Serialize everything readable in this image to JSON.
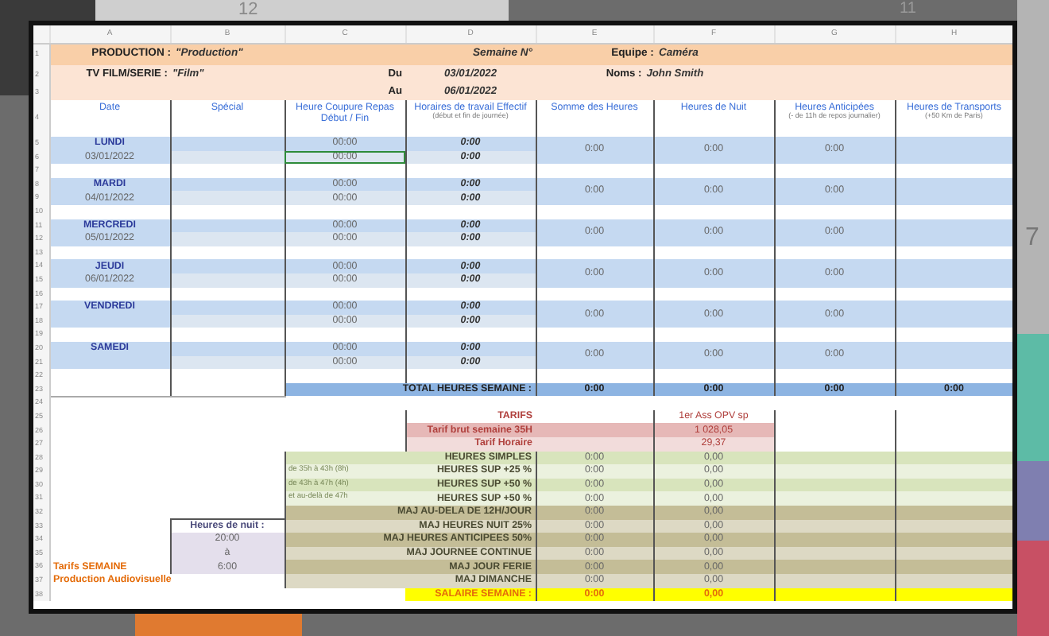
{
  "background_numbers": [
    "12",
    "11",
    "7"
  ],
  "column_letters": [
    "A",
    "B",
    "C",
    "D",
    "E",
    "F",
    "G",
    "H"
  ],
  "row_numbers": [
    "1",
    "2",
    "3",
    "4",
    "5",
    "6",
    "7",
    "8",
    "9",
    "10",
    "11",
    "12",
    "13",
    "14",
    "15",
    "16",
    "17",
    "18",
    "19",
    "20",
    "21",
    "22",
    "23",
    "24",
    "25",
    "26",
    "27",
    "28",
    "29",
    "30",
    "31",
    "32",
    "33",
    "34",
    "35",
    "36",
    "37",
    "38"
  ],
  "production": {
    "label": "PRODUCTION :",
    "value": "\"Production\""
  },
  "semaine": {
    "label": "Semaine N°"
  },
  "equipe": {
    "label": "Equipe :",
    "value": "Caméra"
  },
  "film": {
    "label": "TV FILM/SERIE :",
    "value": "\"Film\""
  },
  "period": {
    "from_label": "Du",
    "from": "03/01/2022",
    "to_label": "Au",
    "to": "06/01/2022"
  },
  "noms": {
    "label": "Noms :",
    "value": "John Smith"
  },
  "columns": [
    {
      "title": "Date"
    },
    {
      "title": "Spécial"
    },
    {
      "title": "Heure Coupure Repas Début / Fin"
    },
    {
      "title": "Horaires de travail Effectif",
      "note": "(début et fin de journée)"
    },
    {
      "title": "Somme des Heures"
    },
    {
      "title": "Heures de Nuit"
    },
    {
      "title": "Heures Anticipées",
      "note": "(- de 11h de repos journalier)"
    },
    {
      "title": "Heures de Transports",
      "note": "(+50 Km de Paris)"
    }
  ],
  "days": [
    {
      "day": "LUNDI",
      "date": "03/01/2022",
      "meal_break": [
        {
          "text": "00:00",
          "selected": false
        },
        {
          "text": "00:00",
          "selected": true
        }
      ],
      "work_hours": [
        "0:00",
        "0:00"
      ],
      "total": "0:00",
      "night": "0:00",
      "early": "0:00"
    },
    {
      "day": "MARDI",
      "date": "04/01/2022",
      "meal_break": [
        {
          "text": "00:00",
          "selected": false
        },
        {
          "text": "00:00",
          "selected": false
        }
      ],
      "work_hours": [
        "0:00",
        "0:00"
      ],
      "total": "0:00",
      "night": "0:00",
      "early": "0:00"
    },
    {
      "day": "MERCREDI",
      "date": "05/01/2022",
      "meal_break": [
        {
          "text": "00:00",
          "selected": false
        },
        {
          "text": "00:00",
          "selected": false
        }
      ],
      "work_hours": [
        "0:00",
        "0:00"
      ],
      "total": "0:00",
      "night": "0:00",
      "early": "0:00"
    },
    {
      "day": "JEUDI",
      "date": "06/01/2022",
      "meal_break": [
        {
          "text": "00:00",
          "selected": false
        },
        {
          "text": "00:00",
          "selected": false
        }
      ],
      "work_hours": [
        "0:00",
        "0:00"
      ],
      "total": "0:00",
      "night": "0:00",
      "early": "0:00"
    },
    {
      "day": "VENDREDI",
      "meal_break": [
        {
          "text": "00:00",
          "selected": false
        },
        {
          "text": "00:00",
          "selected": false
        }
      ],
      "work_hours": [
        "0:00",
        "0:00"
      ],
      "total": "0:00",
      "night": "0:00",
      "early": "0:00"
    },
    {
      "day": "SAMEDI",
      "meal_break": [
        {
          "text": "00:00",
          "selected": false
        },
        {
          "text": "00:00",
          "selected": false
        }
      ],
      "work_hours": [
        "0:00",
        "0:00"
      ],
      "total": "0:00",
      "night": "0:00",
      "early": "0:00"
    }
  ],
  "week_total": {
    "label": "TOTAL HEURES SEMAINE :",
    "values": [
      "0:00",
      "0:00",
      "0:00",
      "0:00"
    ]
  },
  "tarifs": [
    {
      "label": "TARIFS",
      "value": "1er Ass OPV sp"
    },
    {
      "label": "Tarif brut semaine 35H",
      "value": "1 028,05"
    },
    {
      "label": "Tarif Horaire",
      "value": "29,37"
    }
  ],
  "hours": [
    {
      "kind": "simple",
      "label": "HEURES SIMPLES",
      "hours": "0:00",
      "amount": "0,00"
    },
    {
      "kind": "sup",
      "note": "de 35h à 43h (8h)",
      "label": "HEURES SUP +25 %",
      "hours": "0:00",
      "amount": "0,00"
    },
    {
      "kind": "sup",
      "note": "de 43h à 47h (4h)",
      "label": "HEURES SUP +50 %",
      "hours": "0:00",
      "amount": "0,00"
    },
    {
      "kind": "sup",
      "note": "et au-delà de 47h",
      "label": "HEURES SUP +50 %",
      "hours": "0:00",
      "amount": "0,00"
    },
    {
      "kind": "maj",
      "label": "MAJ AU-DELA DE 12H/JOUR",
      "hours": "0:00",
      "amount": "0,00"
    },
    {
      "kind": "maj",
      "label": "MAJ HEURES NUIT 25%",
      "hours": "0:00",
      "amount": "0,00"
    },
    {
      "kind": "maj",
      "label": "MAJ HEURES ANTICIPEES 50%",
      "hours": "0:00",
      "amount": "0,00"
    },
    {
      "kind": "maj",
      "label": "MAJ JOURNEE CONTINUE",
      "hours": "0:00",
      "amount": "0,00"
    },
    {
      "kind": "maj",
      "label": "MAJ JOUR FERIE",
      "hours": "0:00",
      "amount": "0,00"
    },
    {
      "kind": "maj",
      "label": "MAJ DIMANCHE",
      "hours": "0:00",
      "amount": "0,00"
    }
  ],
  "night_hours": {
    "label": "Heures de nuit :",
    "from": "20:00",
    "separator": "à",
    "to": "6:00"
  },
  "footer_notes": [
    "Tarifs SEMAINE",
    "Production Audiovisuelle"
  ],
  "salary": {
    "label": "SALAIRE SEMAINE :",
    "hours": "0:00",
    "amount": "0,00"
  }
}
